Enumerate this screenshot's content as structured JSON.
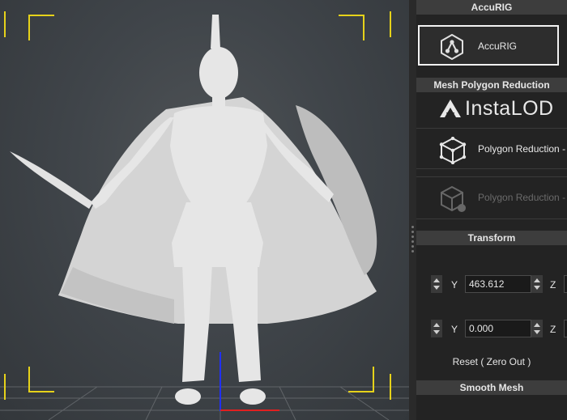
{
  "viewport": {
    "label": "3D character viewport",
    "gizmo_colors": {
      "y": "#2030ff",
      "x": "#e02020"
    }
  },
  "panel": {
    "accurig": {
      "header": "AccuRIG",
      "button_label": "AccuRIG",
      "icon": "accurig-network-icon"
    },
    "mesh_reduction": {
      "header": "Mesh Polygon Reduction",
      "brand": "InstaLOD",
      "brand_icon": "instalod-logo-icon",
      "items": [
        {
          "label": "Polygon Reduction - ",
          "icon": "polygon-cube-icon",
          "enabled": true
        },
        {
          "label": "Polygon Reduction - ",
          "icon": "polygon-cube-gear-icon",
          "enabled": false
        }
      ]
    },
    "transform": {
      "header": "Transform",
      "rows": [
        {
          "y_label": "Y",
          "y_value": "463.612",
          "z_label": "Z"
        },
        {
          "y_label": "Y",
          "y_value": "0.000",
          "z_label": "Z"
        }
      ],
      "reset_label": "Reset ( Zero Out )"
    },
    "smooth": {
      "header": "Smooth Mesh"
    }
  },
  "colors": {
    "frame_guides": "#e6d21a",
    "panel_bg": "#232323",
    "header_bg": "#3d3d3d",
    "disabled_text": "#6a6a6a"
  }
}
